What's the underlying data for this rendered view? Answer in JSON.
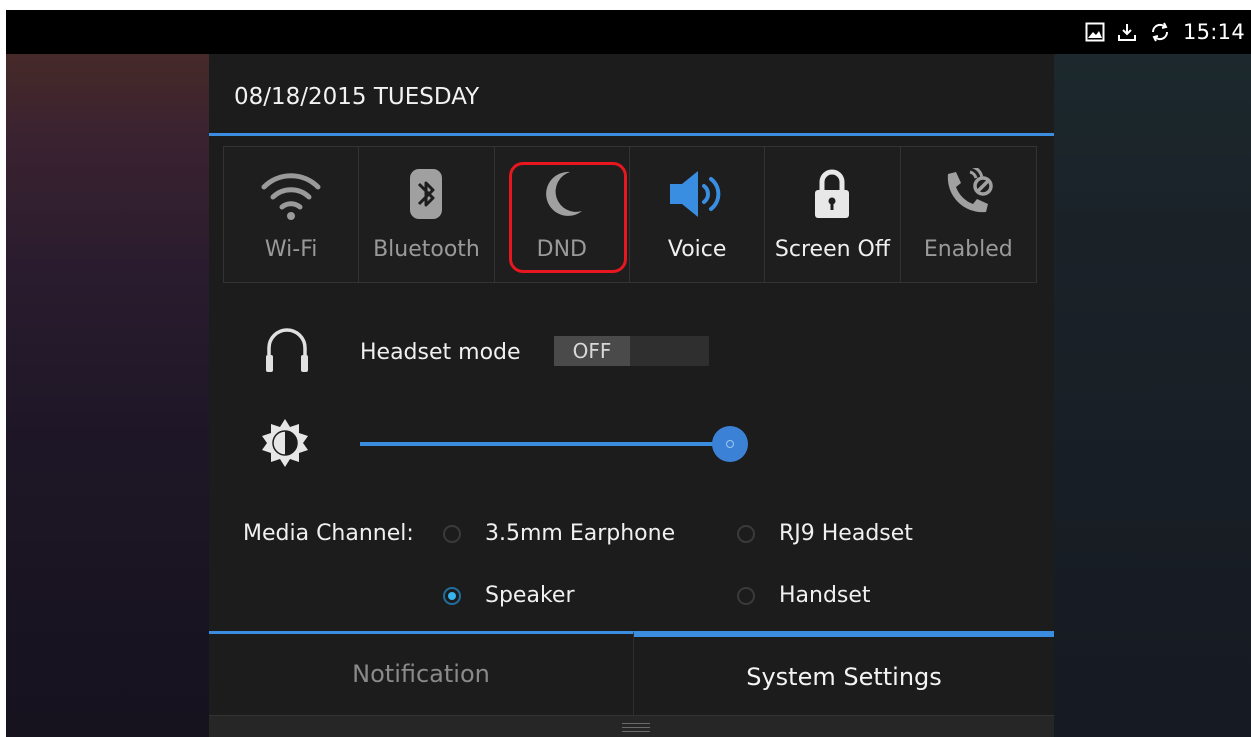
{
  "status_bar": {
    "time": "15:14",
    "icons": [
      "image-icon",
      "download-icon",
      "sync-icon"
    ]
  },
  "panel": {
    "date": "08/18/2015 TUESDAY"
  },
  "quick_settings": [
    {
      "id": "wifi",
      "label": "Wi-Fi",
      "icon": "wifi-icon",
      "active": false
    },
    {
      "id": "bluetooth",
      "label": "Bluetooth",
      "icon": "bluetooth-icon",
      "active": false
    },
    {
      "id": "dnd",
      "label": "DND",
      "icon": "moon-icon",
      "active": false,
      "highlighted": true
    },
    {
      "id": "voice",
      "label": "Voice",
      "icon": "speaker-icon",
      "active": true
    },
    {
      "id": "screen_off",
      "label": "Screen Off",
      "icon": "lock-icon",
      "active": true
    },
    {
      "id": "enabled",
      "label": "Enabled",
      "icon": "call-block-icon",
      "active": false
    }
  ],
  "headset": {
    "label": "Headset mode",
    "toggle_value": "OFF"
  },
  "brightness": {
    "level": 1.0
  },
  "media_channel": {
    "label": "Media Channel:",
    "options": [
      {
        "label": "3.5mm Earphone",
        "selected": false
      },
      {
        "label": "RJ9 Headset",
        "selected": false
      },
      {
        "label": "Speaker",
        "selected": true
      },
      {
        "label": "Handset",
        "selected": false
      }
    ]
  },
  "tabs": [
    {
      "label": "Notification",
      "active": false
    },
    {
      "label": "System Settings",
      "active": true
    }
  ],
  "colors": {
    "accent": "#3b8de0",
    "highlight_border": "#e8161e",
    "panel_bg": "#1c1c1c",
    "radio_on": "#37b3ee"
  }
}
